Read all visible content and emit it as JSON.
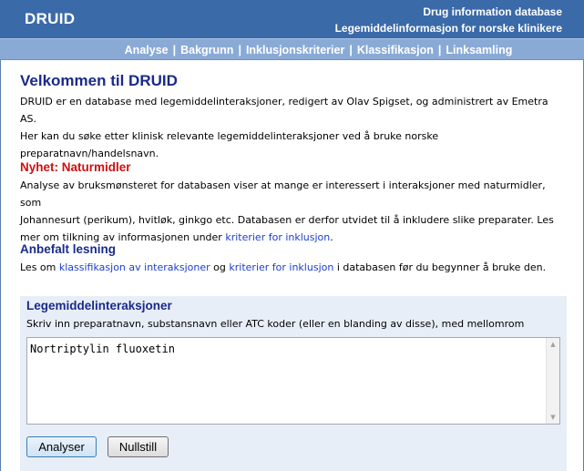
{
  "header": {
    "brand": "DRUID",
    "tagline_line1": "Drug information database",
    "tagline_line2": "Legemiddelinformasjon for norske klinikere"
  },
  "nav": {
    "items": [
      {
        "label": "Analyse"
      },
      {
        "label": "Bakgrunn"
      },
      {
        "label": "Inklusjonskriterier"
      },
      {
        "label": "Klassifikasjon"
      },
      {
        "label": "Linksamling"
      }
    ],
    "separator": "|"
  },
  "welcome": {
    "title": "Velkommen til DRUID",
    "line1": "DRUID er en database med legemiddelinteraksjoner, redigert av Olav Spigset, og administrert av Emetra AS.",
    "line2": "Her kan du søke etter klinisk relevante legemiddelinteraksjoner ved å bruke norske",
    "line3": "preparatnavn/handelsnavn."
  },
  "news": {
    "title": "Nyhet: Naturmidler",
    "line1": "Analyse av bruksmønsteret for databasen viser at mange er interessert i interaksjoner med naturmidler, som",
    "line2": "Johannesurt (perikum), hvitløk, ginkgo etc. Databasen er derfor utvidet til å inkludere slike preparater. Les",
    "line3_prefix": "mer om tilkning av informasjonen under ",
    "line3_link": "kriterier for inklusjon",
    "line3_suffix": "."
  },
  "recommended": {
    "title": "Anbefalt lesning",
    "prefix": "Les om ",
    "link1": "klassifikasjon av interaksjoner",
    "middle": " og ",
    "link2": "kriterier for inklusjon",
    "suffix": " i databasen før du begynner å bruke den."
  },
  "form": {
    "title": "Legemiddelinteraksjoner",
    "help": "Skriv inn preparatnavn, substansnavn eller ATC koder (eller en blanding av disse), med mellomrom mellom.",
    "input_value": "Nortriptylin fluoxetin",
    "analyze_label": "Analyser",
    "reset_label": "Nullstill"
  },
  "colors": {
    "header_bg": "#3a6aa8",
    "nav_bg": "#8aaad6",
    "heading_blue": "#1a2a8a",
    "heading_red": "#cc1111",
    "link": "#1a3ecc",
    "form_bg": "#e8eef8"
  }
}
